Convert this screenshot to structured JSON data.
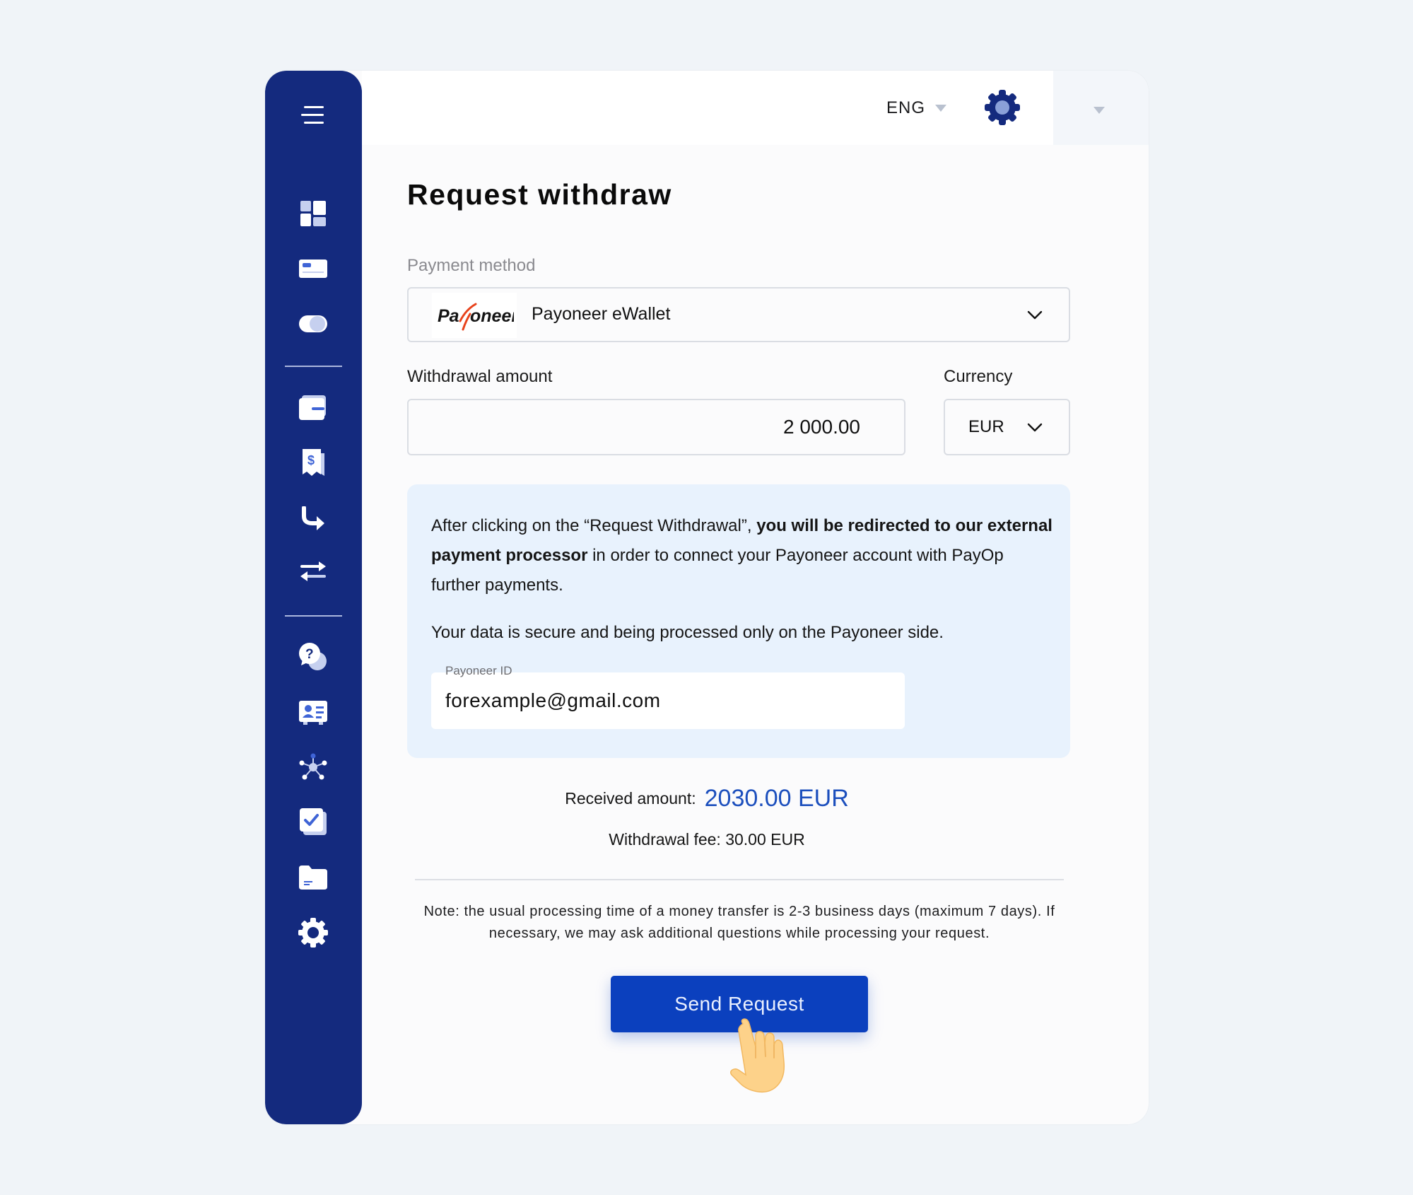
{
  "topbar": {
    "language": "ENG"
  },
  "page": {
    "title": "Request withdraw"
  },
  "payment_method": {
    "label": "Payment method",
    "logo_text": "Payoneer",
    "selected": "Payoneer eWallet"
  },
  "withdrawal": {
    "amount_label": "Withdrawal amount",
    "amount_value": "2 000.00",
    "currency_label": "Currency",
    "currency_value": "EUR"
  },
  "info": {
    "p1_prefix": "After clicking on the “Request Withdrawal”, ",
    "p1_bold": "you will be redirected to our external payment processor",
    "p1_suffix": " in order to connect your Payoneer account with PayOp further payments.",
    "p2": "Your data is secure and being processed only on the Payoneer side.",
    "payoneer_id_label": "Payoneer ID",
    "payoneer_id_value": "forexample@gmail.com"
  },
  "summary": {
    "received_label": "Received amount:",
    "received_value": "2030.00 EUR",
    "fee_text": "Withdrawal fee: 30.00 EUR"
  },
  "note": "Note: the usual processing time of a money transfer is 2-3 business days (maximum 7 days). If necessary, we may ask additional questions while processing your request.",
  "actions": {
    "send_label": "Send Request"
  },
  "colors": {
    "sidebar": "#142a7e",
    "accent": "#0b40be",
    "info_bg": "#e8f2fd",
    "received_value": "#1c4fbd"
  },
  "sidebar_icons": [
    "menu-icon",
    "dashboard-icon",
    "card-icon",
    "toggle-icon",
    "wallet-icon",
    "invoice-icon",
    "redirect-icon",
    "transfer-icon",
    "support-icon",
    "profile-card-icon",
    "network-icon",
    "checklist-icon",
    "folder-icon",
    "settings-icon"
  ]
}
